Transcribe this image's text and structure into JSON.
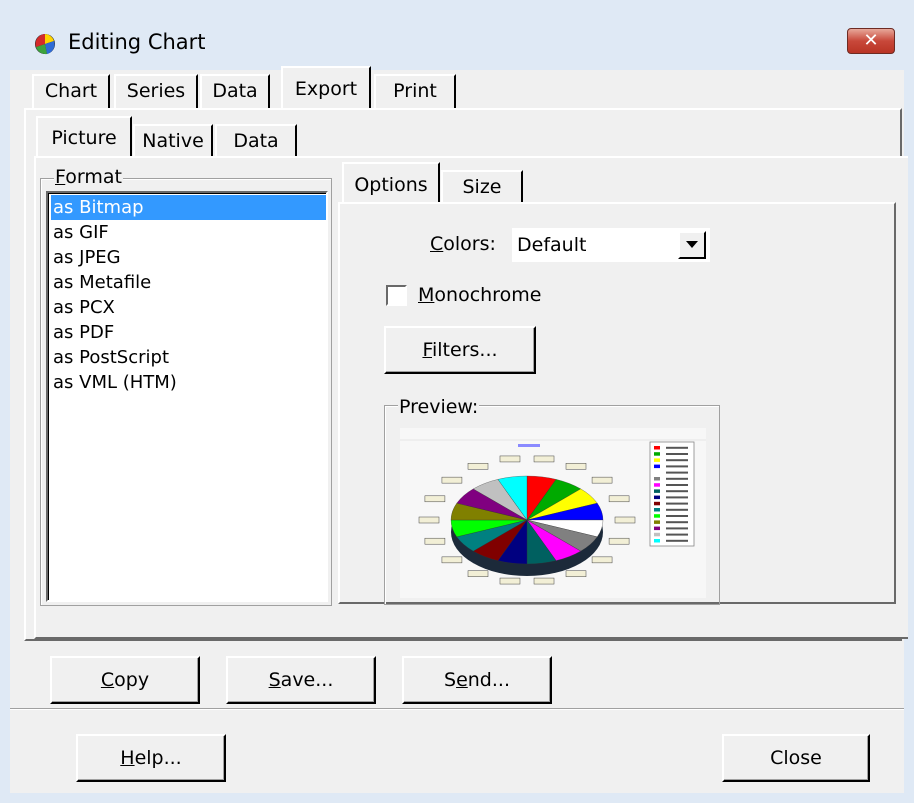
{
  "window": {
    "title": "Editing Chart",
    "close_glyph": "✕"
  },
  "main_tabs": [
    "Chart",
    "Series",
    "Data",
    "Export",
    "Print"
  ],
  "export_tabs": [
    "Picture",
    "Native",
    "Data"
  ],
  "format_group": {
    "label": "Format",
    "items": [
      "as Bitmap",
      "as GIF",
      "as JPEG",
      "as Metafile",
      "as PCX",
      "as PDF",
      "as PostScript",
      "as VML (HTM)"
    ],
    "selected": "as Bitmap"
  },
  "options_tabs": [
    "Options",
    "Size"
  ],
  "options": {
    "colors_label": "Colors:",
    "colors_value": "Default",
    "monochrome_label": "Monochrome",
    "monochrome_checked": false,
    "filters_button": "Filters...",
    "preview_label": "Preview:"
  },
  "buttons": {
    "copy": "Copy",
    "save": "Save...",
    "send": "Send...",
    "help": "Help...",
    "close": "Close"
  },
  "colors": {
    "selection": "#3399ff",
    "pie_slices": [
      "#ff0000",
      "#00aa00",
      "#ffff00",
      "#0000ff",
      "#ffffff",
      "#808080",
      "#ff00ff",
      "#006060",
      "#000080",
      "#800000",
      "#008080",
      "#00ff00",
      "#808000",
      "#800080",
      "#c0c0c0",
      "#00ffff"
    ]
  },
  "icons": {
    "app": "chart-pie-icon",
    "dropdown": "chevron-down-icon"
  }
}
